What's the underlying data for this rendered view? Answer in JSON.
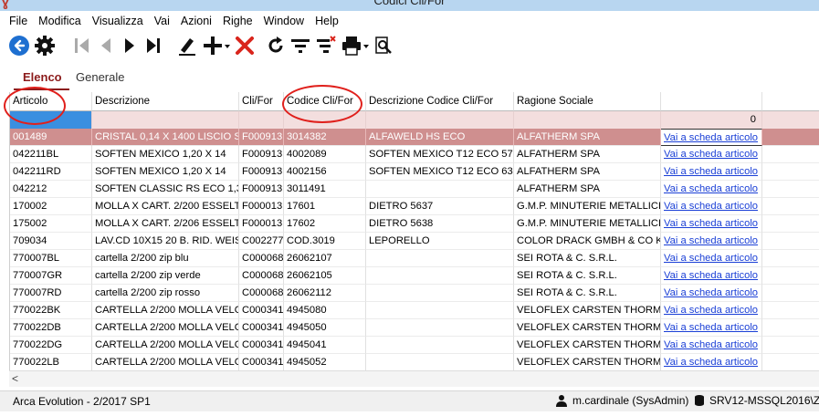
{
  "window": {
    "title": "Codici Cli/For"
  },
  "menu": [
    "File",
    "Modifica",
    "Visualizza",
    "Vai",
    "Azioni",
    "Righe",
    "Window",
    "Help"
  ],
  "toolbar": {
    "icons": [
      "back-circle-icon",
      "gear-icon",
      "first-record-icon",
      "previous-record-icon",
      "next-record-icon",
      "last-record-icon",
      "edit-icon",
      "add-icon",
      "delete-icon",
      "refresh-icon",
      "filter-icon",
      "clear-filter-icon",
      "print-icon",
      "zoom-preview-icon"
    ],
    "colors": {
      "back": "#1e6fd0",
      "delete": "#d9251c"
    }
  },
  "tabs": {
    "active": "Elenco",
    "inactive": "Generale"
  },
  "grid": {
    "columns": [
      "Articolo",
      "Descrizione",
      "Cli/For",
      "Codice Cli/For",
      "Descrizione Codice Cli/For",
      "Ragione Sociale",
      ""
    ],
    "filter_count": "0",
    "rows": [
      [
        "001489",
        "CRISTAL 0,14 X 1400 LISCIO  SPE",
        "F000913",
        "3014382",
        "ALFAWELD HS ECO",
        "ALFATHERM SPA",
        "Vai a scheda articolo"
      ],
      [
        "042211BL",
        "SOFTEN MEXICO          1,20 X 14",
        "F000913",
        "4002089",
        "SOFTEN MEXICO T12 ECO 570 C",
        "ALFATHERM SPA",
        "Vai a scheda articolo"
      ],
      [
        "042211RD",
        "SOFTEN MEXICO          1,20 X 14",
        "F000913",
        "4002156",
        "SOFTEN MEXICO T12 ECO 633 C",
        "ALFATHERM SPA",
        "Vai a scheda articolo"
      ],
      [
        "042212",
        "SOFTEN CLASSIC RS ECO   1,30",
        "F000913",
        "3011491",
        "",
        "ALFATHERM SPA",
        "Vai a scheda articolo"
      ],
      [
        "170002",
        "MOLLA X CART. 2/200 ESSELTE",
        "F000013",
        "17601",
        "DIETRO 5637",
        "G.M.P. MINUTERIE METALLICHE",
        "Vai a scheda articolo"
      ],
      [
        "175002",
        "MOLLA X CART. 2/206 ESSELTE",
        "F000013",
        "17602",
        "DIETRO 5638",
        "G.M.P. MINUTERIE METALLICHE",
        "Vai a scheda articolo"
      ],
      [
        "709034",
        "LAV.CD 10X15 20 B. RID.   WEIS",
        "C002277",
        "COD.3019",
        "LEPORELLO",
        "COLOR DRACK GMBH & CO KG",
        "Vai a scheda articolo"
      ],
      [
        "770007BL",
        "cartella 2/200 zip blu",
        "C000068",
        "26062107",
        "",
        "SEI ROTA & C. S.R.L.",
        "Vai a scheda articolo"
      ],
      [
        "770007GR",
        "cartella 2/200 zip verde",
        "C000068",
        "26062105",
        "",
        "SEI ROTA & C. S.R.L.",
        "Vai a scheda articolo"
      ],
      [
        "770007RD",
        "cartella 2/200 zip rosso",
        "C000068",
        "26062112",
        "",
        "SEI ROTA & C. S.R.L.",
        "Vai a scheda articolo"
      ],
      [
        "770022BK",
        "CARTELLA 2/200 MOLLA VELOFI",
        "C000341",
        "4945080",
        "",
        "VELOFLEX CARSTEN THORMAH",
        "Vai a scheda articolo"
      ],
      [
        "770022DB",
        "CARTELLA 2/200 MOLLA VELOFI",
        "C000341",
        "4945050",
        "",
        "VELOFLEX CARSTEN THORMAH",
        "Vai a scheda articolo"
      ],
      [
        "770022DG",
        "CARTELLA 2/200 MOLLA VELOFI",
        "C000341",
        "4945041",
        "",
        "VELOFLEX CARSTEN THORMAH",
        "Vai a scheda articolo"
      ],
      [
        "770022LB",
        "CARTELLA 2/200 MOLLA VELOFI",
        "C000341",
        "4945052",
        "",
        "VELOFLEX CARSTEN THORMAH",
        "Vai a scheda articolo"
      ]
    ]
  },
  "status": {
    "left": "Arca Evolution - 2/2017 SP1",
    "user": "m.cardinale (SysAdmin)",
    "server": "SRV12-MSSQL2016\\ZE"
  }
}
